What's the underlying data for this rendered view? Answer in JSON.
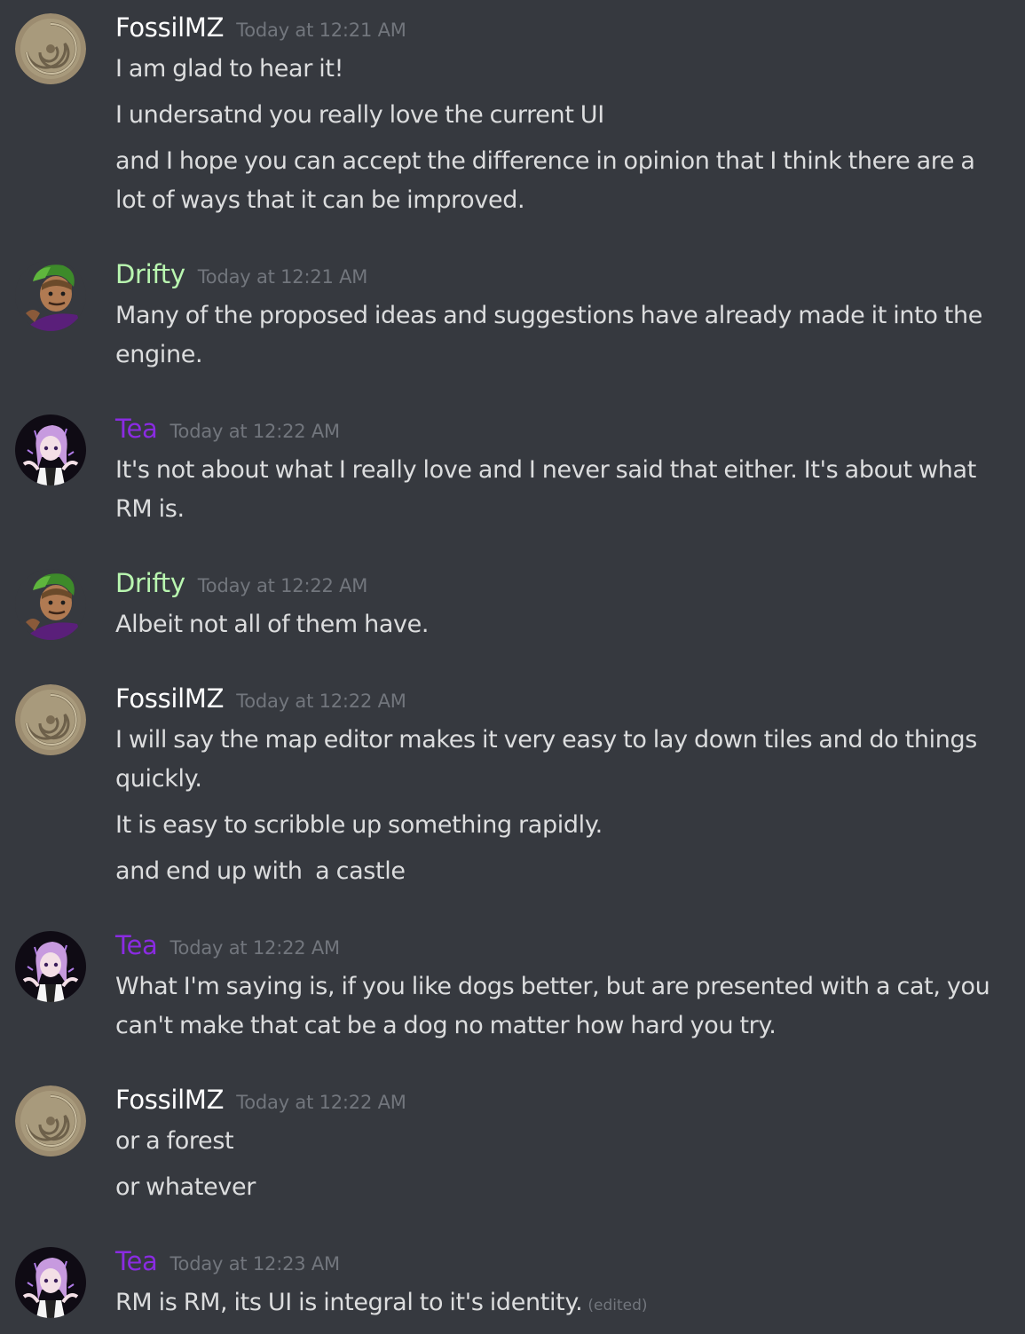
{
  "users": {
    "fossil": {
      "name": "FossilMZ",
      "color": "#ffffff"
    },
    "drifty": {
      "name": "Drifty",
      "color": "#b9f7b0"
    },
    "tea": {
      "name": "Tea",
      "color": "#8a2be2"
    }
  },
  "messages": [
    {
      "author": "FossilMZ",
      "timestamp": "Today at 12:21 AM",
      "lines": [
        "I am glad to hear it!",
        "I undersatnd you really love the current UI",
        "and I hope you can accept the difference in opinion that I think there are a lot of ways that it can be improved."
      ]
    },
    {
      "author": "Drifty",
      "timestamp": "Today at 12:21 AM",
      "lines": [
        "Many of the proposed ideas and suggestions have already made it into the engine."
      ]
    },
    {
      "author": "Tea",
      "timestamp": "Today at 12:22 AM",
      "lines": [
        "It's not about what I really love and I never said that either. It's about what RM is."
      ]
    },
    {
      "author": "Drifty",
      "timestamp": "Today at 12:22 AM",
      "lines": [
        "Albeit not all of them have."
      ]
    },
    {
      "author": "FossilMZ",
      "timestamp": "Today at 12:22 AM",
      "lines": [
        "I will say the map editor makes it very easy to lay down tiles and do things quickly.",
        "It is easy to scribble up something rapidly.",
        "and end up with  a castle"
      ]
    },
    {
      "author": "Tea",
      "timestamp": "Today at 12:22 AM",
      "lines": [
        "What I'm saying is, if you like dogs better, but are presented with a cat, you can't make that cat be a dog no matter how hard you try."
      ]
    },
    {
      "author": "FossilMZ",
      "timestamp": "Today at 12:22 AM",
      "lines": [
        "or a forest",
        "or whatever"
      ]
    },
    {
      "author": "Tea",
      "timestamp": "Today at 12:23 AM",
      "lines": [
        "RM is RM, its UI is integral to it's identity."
      ],
      "edited_label": "(edited)"
    }
  ]
}
